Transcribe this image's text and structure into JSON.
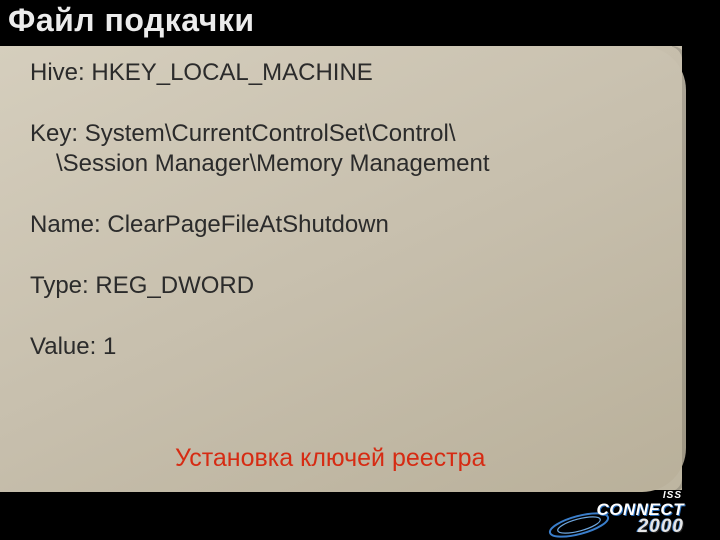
{
  "title": "Файл подкачки",
  "registry": {
    "hive_label": "Hive:",
    "hive_value": "HKEY_LOCAL_MACHINE",
    "key_label": "Key:",
    "key_line1": "System\\CurrentControlSet\\Control\\",
    "key_line2": "\\Session Manager\\Memory Management",
    "name_label": "Name:",
    "name_value": "ClearPageFileAtShutdown",
    "type_label": "Type:",
    "type_value": "REG_DWORD",
    "value_label": "Value:",
    "value_value": "1"
  },
  "footer_note": "Установка ключей реестра",
  "logo": {
    "iss": "ISS",
    "connect": "CONNECT",
    "year": "2000"
  }
}
